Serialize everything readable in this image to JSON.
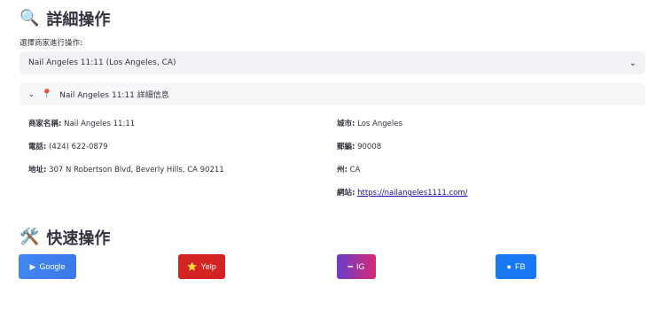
{
  "detail_section": {
    "emoji": "🔍",
    "title": "詳細操作"
  },
  "select": {
    "label": "選擇商家進行操作:",
    "value": "Nail Angeles 11:11 (Los Angeles, CA)",
    "chevron": "⌄"
  },
  "expander": {
    "caret": "⌄",
    "icon": "📍",
    "title": "Nail Angeles 11:11 詳細信息"
  },
  "details": {
    "name_label": "商家名稱:",
    "name_value": "Nail Angeles 11:11",
    "phone_label": "電話:",
    "phone_value": "(424) 622-0879",
    "address_label": "地址:",
    "address_value": "307 N Robertson Blvd, Beverly Hills, CA 90211",
    "city_label": "城市:",
    "city_value": "Los Angeles",
    "zip_label": "郵編:",
    "zip_value": "90008",
    "state_label": "州:",
    "state_value": "CA",
    "website_label": "網站:",
    "website_value": "https://nailangeles1111.com/"
  },
  "quick_section": {
    "emoji": "🛠️",
    "title": "快速操作"
  },
  "buttons": {
    "google": {
      "icon": "▶",
      "label": "Google"
    },
    "yelp": {
      "icon": "⭐",
      "label": "Yelp"
    },
    "ig": {
      "icon": "━",
      "label": "IG"
    },
    "fb": {
      "icon": "●",
      "label": "FB"
    }
  },
  "colors": {
    "google": "#4285f4",
    "yelp": "#d32323",
    "ig_start": "#6a3dc8",
    "ig_end": "#d62976",
    "fb": "#1877f2"
  }
}
